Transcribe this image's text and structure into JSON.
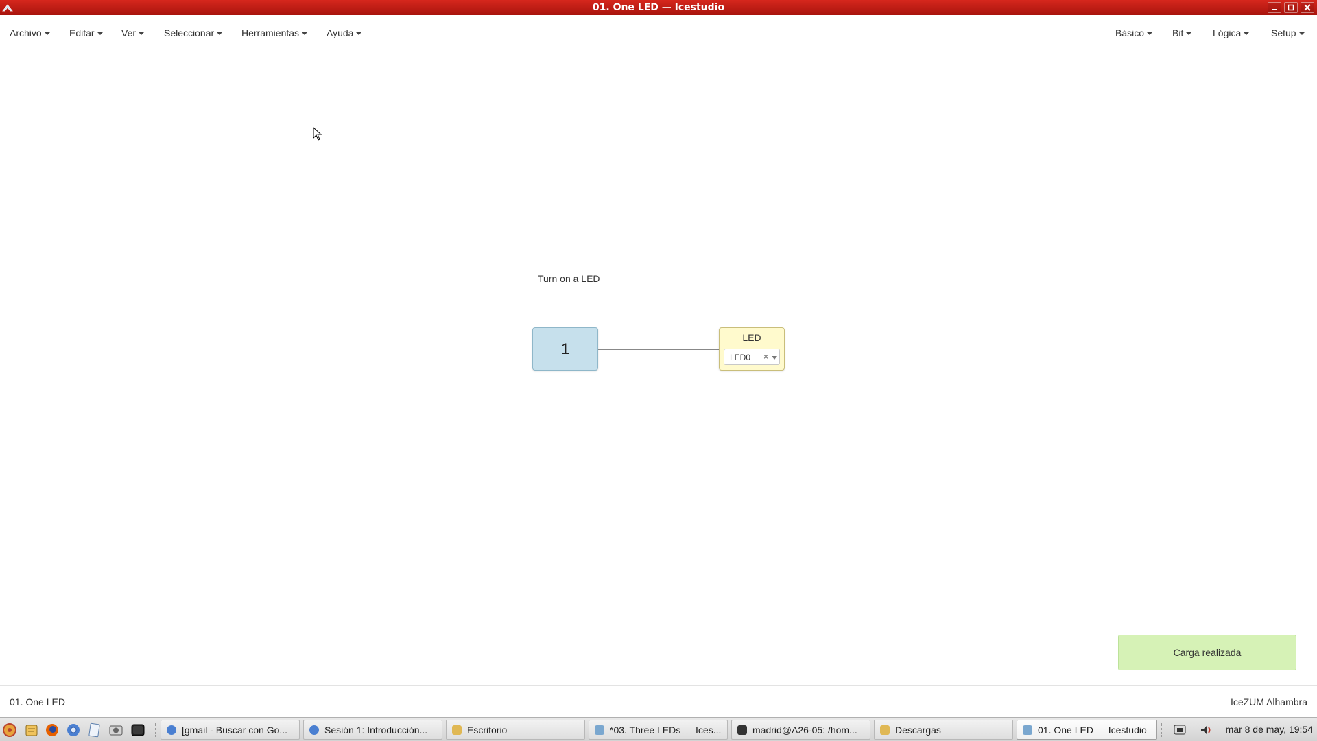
{
  "window": {
    "title": "01. One LED — Icestudio"
  },
  "menubar": {
    "left": [
      {
        "label": "Archivo"
      },
      {
        "label": "Editar"
      },
      {
        "label": "Ver"
      },
      {
        "label": "Seleccionar"
      },
      {
        "label": "Herramientas"
      },
      {
        "label": "Ayuda"
      }
    ],
    "right": [
      {
        "label": "Básico"
      },
      {
        "label": "Bit"
      },
      {
        "label": "Lógica"
      },
      {
        "label": "Setup"
      }
    ]
  },
  "canvas": {
    "comment": "Turn on a LED",
    "constant_block": {
      "value": "1"
    },
    "led_block": {
      "name": "LED",
      "pin": "LED0",
      "clear": "×"
    }
  },
  "toast": {
    "message": "Carga realizada"
  },
  "footer": {
    "project_name": "01. One LED",
    "board": "IceZUM Alhambra"
  },
  "taskbar": {
    "launchers": [
      "system-menu-icon",
      "files-icon",
      "firefox-icon",
      "chromium-icon",
      "text-editor-icon",
      "screenshot-icon",
      "terminal-icon"
    ],
    "tasks": [
      {
        "label": "[gmail - Buscar con Go...",
        "icon": "chromium-icon"
      },
      {
        "label": "Sesión 1: Introducción...",
        "icon": "chromium-icon"
      },
      {
        "label": "Escritorio",
        "icon": "folder-icon"
      },
      {
        "label": "*03. Three LEDs — Ices...",
        "icon": "icestudio-icon"
      },
      {
        "label": "madrid@A26-05: /hom...",
        "icon": "terminal-icon"
      },
      {
        "label": "Descargas",
        "icon": "folder-icon"
      },
      {
        "label": "01. One LED — Icestudio",
        "icon": "icestudio-icon"
      }
    ],
    "clock": "mar  8 de may, 19:54"
  }
}
